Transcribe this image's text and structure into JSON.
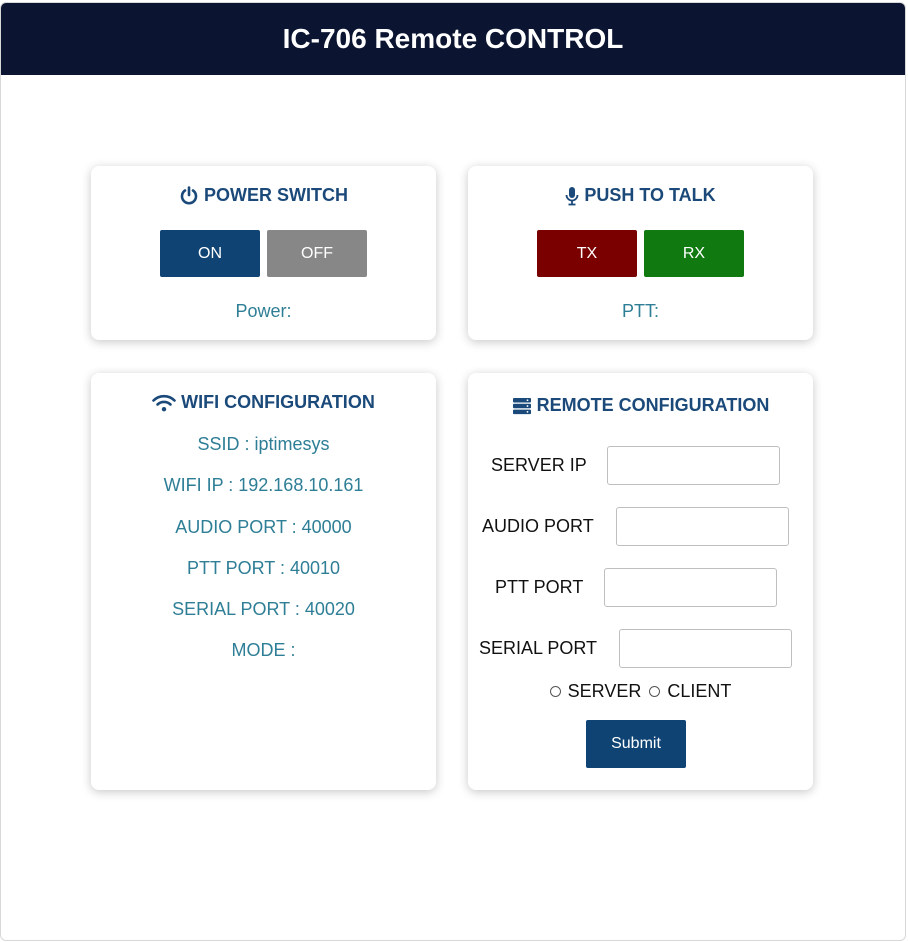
{
  "header": {
    "title": "IC-706 Remote CONTROL"
  },
  "power": {
    "title": "POWER SWITCH",
    "icon": "power-icon",
    "on_label": "ON",
    "off_label": "OFF",
    "status": "Power:"
  },
  "ptt": {
    "title": "PUSH TO TALK",
    "icon": "microphone-icon",
    "tx_label": "TX",
    "rx_label": "RX",
    "status": "PTT:"
  },
  "wifi": {
    "title": "WIFI CONFIGURATION",
    "icon": "wifi-icon",
    "ssid": "SSID : iptimesys",
    "ip": "WIFI IP : 192.168.10.161",
    "audio_port": "AUDIO PORT : 40000",
    "ptt_port": "PTT PORT : 40010",
    "serial_port": "SERIAL PORT : 40020",
    "mode": "MODE :"
  },
  "remote": {
    "title": "REMOTE CONFIGURATION",
    "icon": "server-icon",
    "server_ip_label": "SERVER IP",
    "audio_port_label": "AUDIO PORT",
    "ptt_port_label": "PTT PORT",
    "serial_port_label": "SERIAL PORT",
    "server_ip_value": "",
    "audio_port_value": "",
    "ptt_port_value": "",
    "serial_port_value": "",
    "radio_server": "SERVER",
    "radio_client": "CLIENT",
    "submit_label": "Submit"
  },
  "colors": {
    "header_bg": "#0b1430",
    "primary": "#0f4374",
    "off": "#878787",
    "tx": "#7a0000",
    "rx": "#107a10",
    "status_text": "#2e7e96",
    "title_text": "#1b4a7a"
  }
}
